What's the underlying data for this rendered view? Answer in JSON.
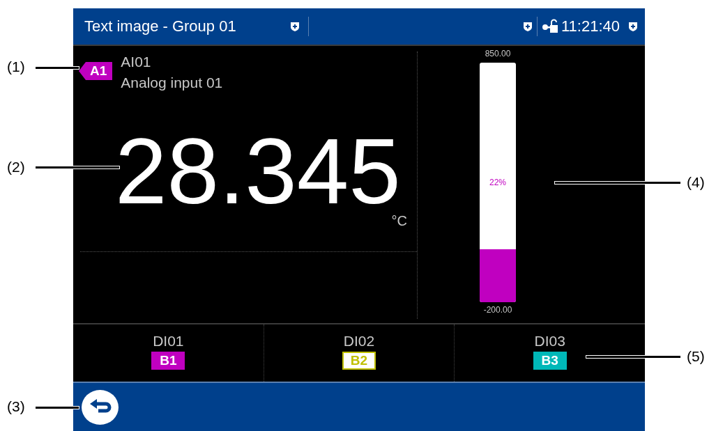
{
  "header": {
    "title": "Text image - Group 01",
    "time": "11:21:40"
  },
  "channel": {
    "tag": "A1",
    "color": "#c000c0",
    "id": "AI01",
    "name": "Analog input 01",
    "value": "28.345",
    "unit": "°C"
  },
  "bar": {
    "max": "850.00",
    "min": "-200.00",
    "percent": "22%",
    "level": 0.22,
    "color": "#c000c0"
  },
  "digital": [
    {
      "id": "DI01",
      "tag": "B1",
      "color": "#c000c0",
      "kind": "filled"
    },
    {
      "id": "DI02",
      "tag": "B2",
      "color": "#c0c000",
      "kind": "outlined"
    },
    {
      "id": "DI03",
      "tag": "B3",
      "color": "#00b8b8",
      "kind": "filled"
    }
  ],
  "callouts": [
    {
      "label": "(1)"
    },
    {
      "label": "(2)"
    },
    {
      "label": "(3)"
    },
    {
      "label": "(4)"
    },
    {
      "label": "(5)"
    }
  ]
}
